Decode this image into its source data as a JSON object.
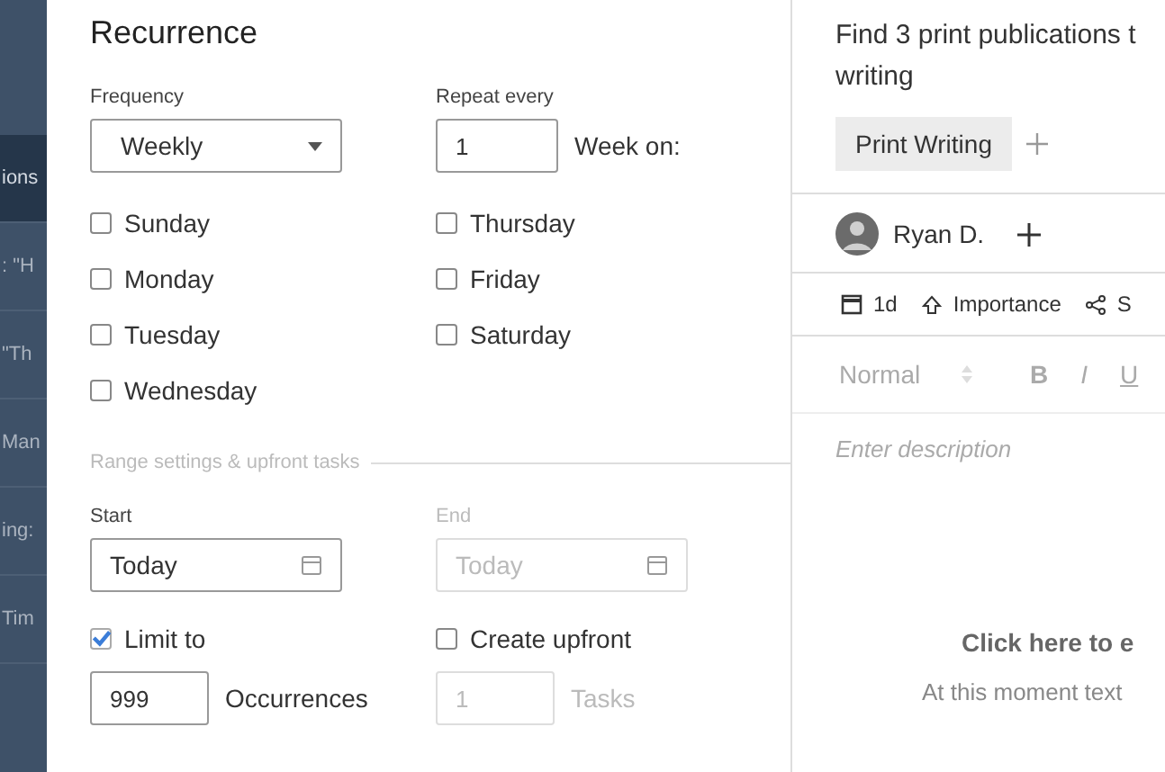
{
  "sidebar": {
    "items": [
      {
        "text": "ions",
        "selected": true
      },
      {
        "text": ": \"H",
        "selected": false
      },
      {
        "text": "\"Th",
        "selected": false
      },
      {
        "text": "Man",
        "selected": false
      },
      {
        "text": "ing:",
        "selected": false
      },
      {
        "text": "Tim",
        "selected": false
      }
    ]
  },
  "recurrence": {
    "title": "Recurrence",
    "frequency": {
      "label": "Frequency",
      "value": "Weekly"
    },
    "repeat": {
      "label": "Repeat every",
      "value": "1",
      "unit": "Week on:"
    },
    "days_left": [
      {
        "label": "Sunday",
        "checked": false
      },
      {
        "label": "Monday",
        "checked": false
      },
      {
        "label": "Tuesday",
        "checked": false
      },
      {
        "label": "Wednesday",
        "checked": false
      }
    ],
    "days_right": [
      {
        "label": "Thursday",
        "checked": false
      },
      {
        "label": "Friday",
        "checked": false
      },
      {
        "label": "Saturday",
        "checked": false
      }
    ],
    "section": "Range settings & upfront tasks",
    "start": {
      "label": "Start",
      "value": "Today",
      "disabled": false
    },
    "end": {
      "label": "End",
      "value": "Today",
      "disabled": true
    },
    "limit": {
      "label": "Limit to",
      "checked": true,
      "value": "999",
      "unit": "Occurrences",
      "disabled": false
    },
    "upfront": {
      "label": "Create upfront",
      "checked": false,
      "value": "1",
      "unit": "Tasks",
      "disabled": true
    }
  },
  "task": {
    "title": "Find 3 print publications t",
    "title_line2": "writing",
    "tag": "Print Writing",
    "assignee": "Ryan D.",
    "toolbar": [
      {
        "kind": "duration",
        "label": "1d"
      },
      {
        "kind": "importance",
        "label": "Importance"
      },
      {
        "kind": "share",
        "label": "S"
      }
    ],
    "format": {
      "style": "Normal",
      "buttons": [
        "B",
        "I",
        "U"
      ]
    },
    "description_placeholder": "Enter description",
    "hint": "Click here to e",
    "hint_line2": "At this moment text"
  }
}
